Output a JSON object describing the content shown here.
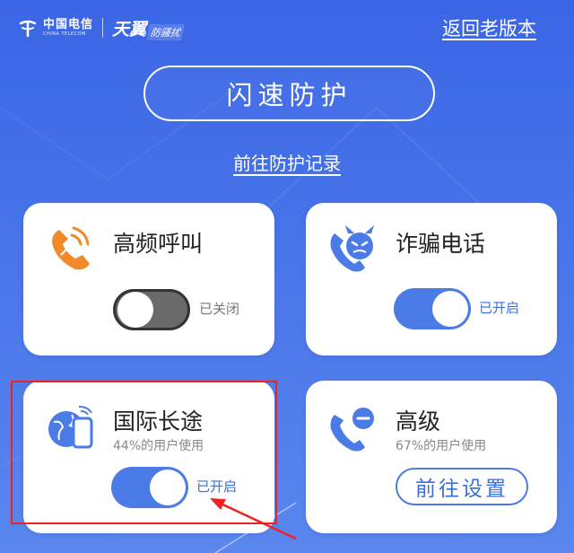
{
  "header": {
    "brand_cn": "中国电信",
    "brand_en": "CHINA TELECOM",
    "product_main": "天翼",
    "product_sub": "防骚扰",
    "old_version_link": "返回老版本"
  },
  "main": {
    "flash_button": "闪速防护",
    "record_link": "前往防护记录"
  },
  "cards": [
    {
      "title": "高频呼叫",
      "toggle_state": "off",
      "toggle_label": "已关闭",
      "icon": "phone-high-frequency-icon"
    },
    {
      "title": "诈骗电话",
      "toggle_state": "on",
      "toggle_label": "已开启",
      "icon": "devil-fraud-icon"
    },
    {
      "title": "国际长途",
      "subtitle": "44%的用户使用",
      "toggle_state": "on",
      "toggle_label": "已开启",
      "icon": "globe-phone-icon"
    },
    {
      "title": "高级",
      "subtitle": "67%的用户使用",
      "button": "前往设置",
      "icon": "phone-minus-icon"
    }
  ],
  "colors": {
    "background": "#4470e8",
    "accent": "#4b7be6",
    "icon_orange": "#f08a2a",
    "highlight": "#ee2222"
  }
}
